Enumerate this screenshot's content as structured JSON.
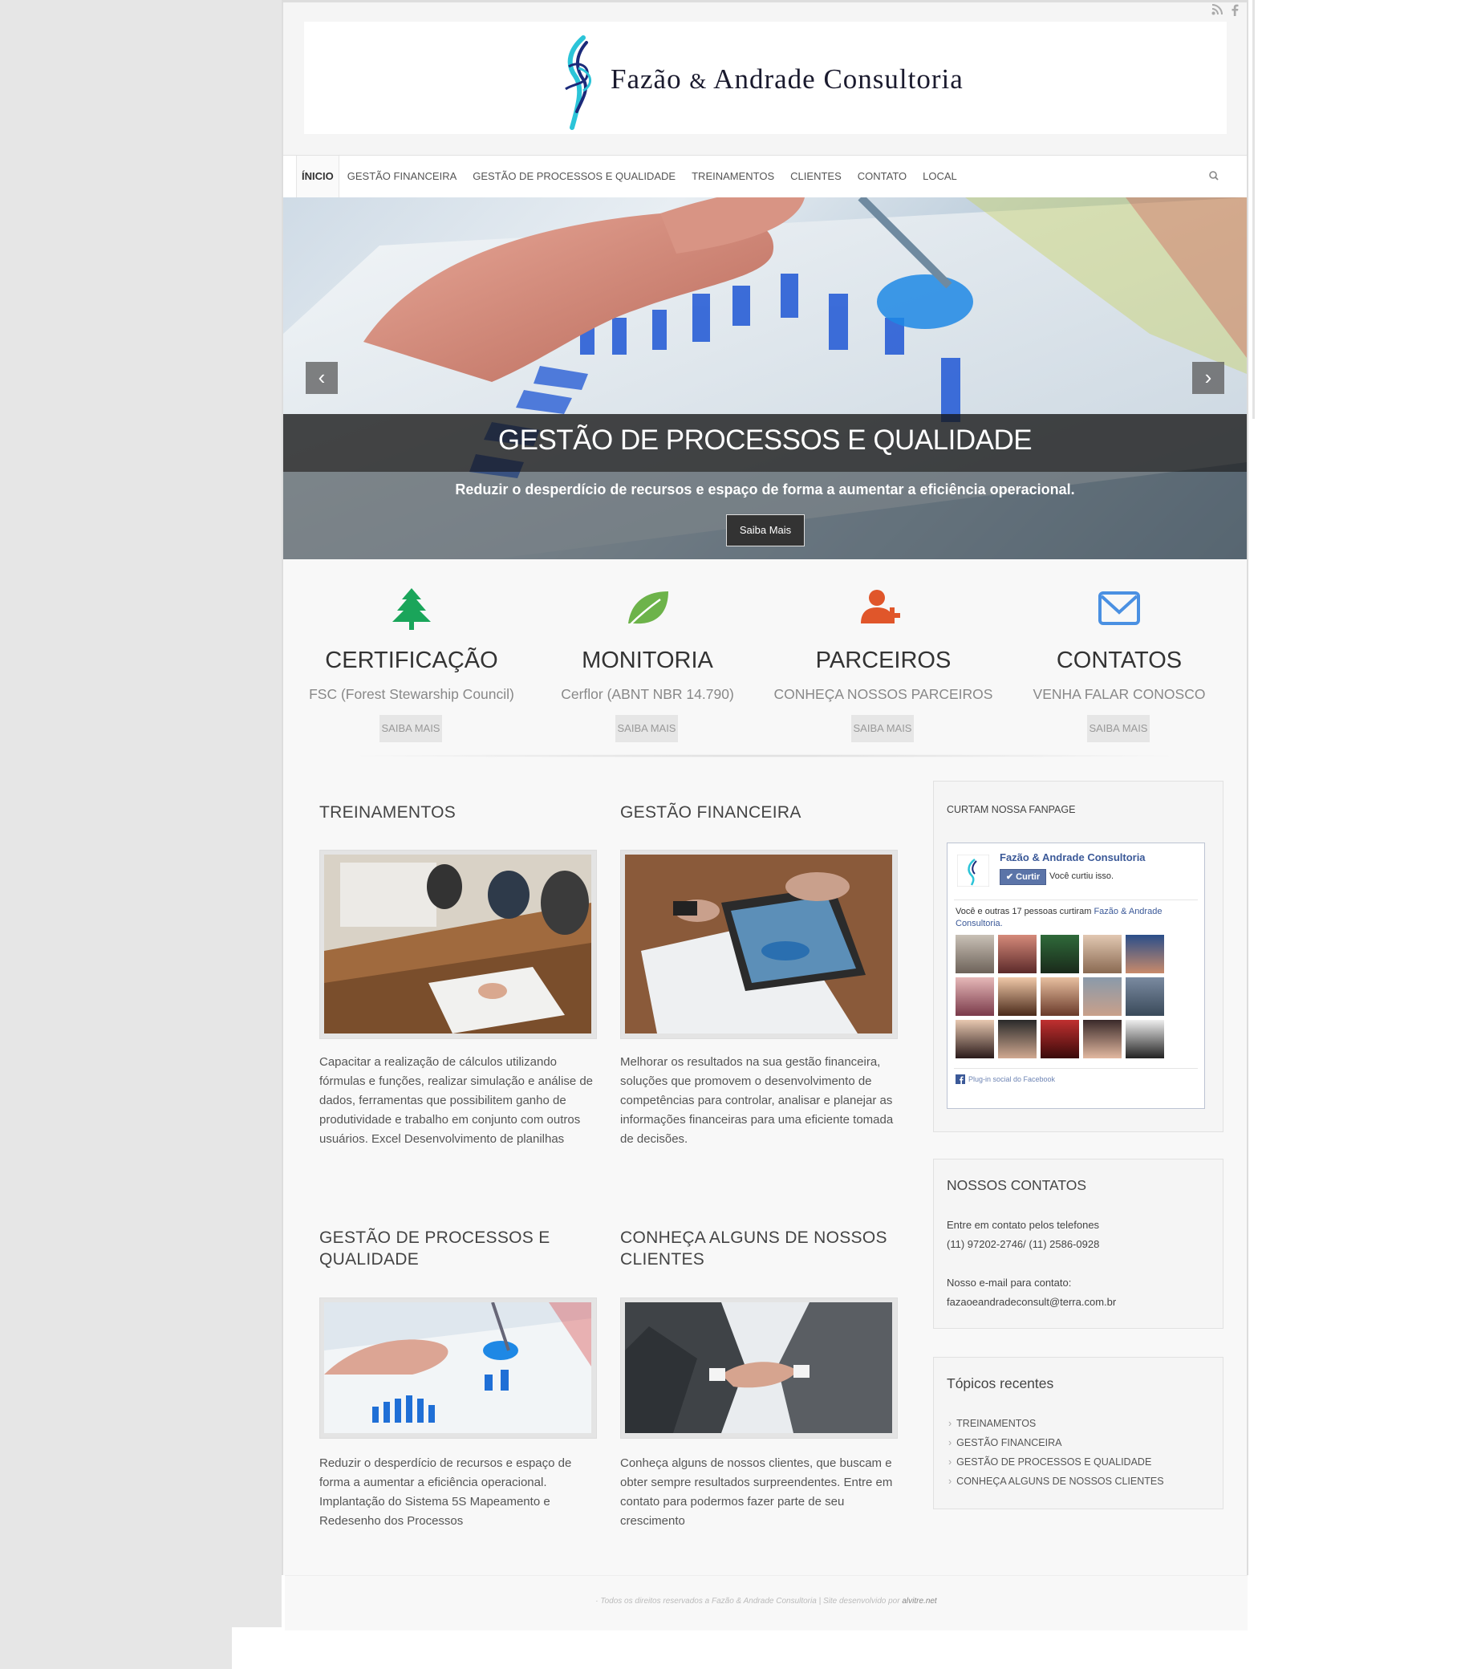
{
  "header": {
    "brand_main": "Fazão",
    "brand_amp": "&",
    "brand_second": "Andrade",
    "brand_third": "Consultoria",
    "social": [
      "rss-icon",
      "facebook-icon"
    ]
  },
  "nav": {
    "items": [
      "ÍNICIO",
      "GESTÃO FINANCEIRA",
      "GESTÃO DE PROCESSOS E QUALIDADE",
      "TREINAMENTOS",
      "CLIENTES",
      "CONTATO",
      "LOCAL"
    ],
    "active": "ÍNICIO"
  },
  "slider": {
    "title": "GESTÃO DE PROCESSOS E QUALIDADE",
    "subtitle": "Reduzir o desperdício de recursos e espaço de forma a aumentar a eficiência operacional.",
    "button": "Saiba Mais"
  },
  "features": [
    {
      "title": "CERTIFICAÇÃO",
      "subtitle": "FSC (Forest Stewarship Council)",
      "button": "SAIBA MAIS",
      "icon": "tree-icon",
      "color": "#1aa55a"
    },
    {
      "title": "MONITORIA",
      "subtitle": "Cerflor (ABNT NBR 14.790)",
      "button": "SAIBA MAIS",
      "icon": "leaf-icon",
      "color": "#6db34a"
    },
    {
      "title": "PARCEIROS",
      "subtitle": "CONHEÇA NOSSOS PARCEIROS",
      "button": "SAIBA MAIS",
      "icon": "add-user-icon",
      "color": "#e0562a"
    },
    {
      "title": "CONTATOS",
      "subtitle": "VENHA FALAR CONOSCO",
      "button": "SAIBA MAIS",
      "icon": "envelope-icon",
      "color": "#4a90e2"
    }
  ],
  "posts": [
    {
      "title": "TREINAMENTOS",
      "text": "Capacitar a realização de cálculos utilizando fórmulas e funções,  realizar simulação e análise de dados,  ferramentas que possibilitem ganho de produtividade e trabalho em conjunto  com outros usuários. Excel Desenvolvimento de planilhas"
    },
    {
      "title": "GESTÃO FINANCEIRA",
      "text": "Melhorar os resultados na sua gestão financeira, soluções que promovem o desenvolvimento de competências para controlar, analisar e  planejar as informações financeiras para uma eficiente tomada de decisões."
    },
    {
      "title": "GESTÃO DE PROCESSOS E QUALIDADE",
      "text": "   Reduzir o desperdício de recursos e espaço de forma a aumentar a eficiência operacional. Implantação do Sistema 5S Mapeamento e Redesenho dos Processos"
    },
    {
      "title": "CONHEÇA ALGUNS DE NOSSOS CLIENTES",
      "text": "Conheça alguns de nossos clientes, que  buscam e obter sempre resultados surpreendentes. Entre em contato para podermos fazer parte de seu crescimento"
    }
  ],
  "sidebar": {
    "fanpage": {
      "title": "CURTAM NOSSA FANPAGE",
      "page_name": "Fazão & Andrade Consultoria",
      "like_label": "Curtir",
      "liked_text": "Você curtiu isso.",
      "likes_text": "Você e outras 17 pessoas curtiram ",
      "likes_link": "Fazão & Andrade Consultoria.",
      "plugin_text": "Plug-in social do Facebook"
    },
    "contacts": {
      "title": "NOSSOS CONTATOS",
      "phone_label": "Entre em contato pelos telefones",
      "phones": "(11) 97202-2746/ (11) 2586-0928",
      "email_label": "Nosso e-mail para contato:",
      "email": "fazaoeandradeconsult@terra.com.br"
    },
    "recent": {
      "title": "Tópicos recentes",
      "items": [
        "TREINAMENTOS",
        "GESTÃO FINANCEIRA",
        "GESTÃO DE PROCESSOS E QUALIDADE",
        "CONHEÇA ALGUNS DE NOSSOS CLIENTES"
      ]
    }
  },
  "footer": {
    "text": "Todos os direitos reservados a Fazão & Andrade Consultoria | Site desenvolvido por ",
    "link": "alvitre.net"
  }
}
